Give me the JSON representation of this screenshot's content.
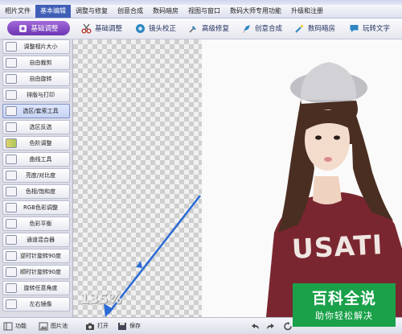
{
  "menu": {
    "items": [
      "相片文件",
      "基本编辑",
      "调整与修复",
      "创意合成",
      "数码暗房",
      "视图与窗口",
      "数码大师专用功能",
      "升级和注册"
    ],
    "active_index": 1
  },
  "toolbar": {
    "main_label": "基础调整",
    "tabs": [
      {
        "label": "基础调整",
        "icon": "scissors-icon"
      },
      {
        "label": "镜头校正",
        "icon": "lens-icon"
      },
      {
        "label": "高级修复",
        "icon": "pin-icon"
      },
      {
        "label": "创意合成",
        "icon": "rocket-icon"
      },
      {
        "label": "数码暗房",
        "icon": "magic-wand-icon"
      },
      {
        "label": "玩转文字",
        "icon": "chat-bubble-icon"
      }
    ]
  },
  "sidebar": {
    "items": [
      {
        "label": "调整相片大小"
      },
      {
        "label": "自由裁剪"
      },
      {
        "label": "自由旋转"
      },
      {
        "label": "排版与打印"
      },
      {
        "label": "选区/套索工具"
      },
      {
        "label": "选区反选"
      },
      {
        "label": "色阶调整"
      },
      {
        "label": "曲线工具"
      },
      {
        "label": "亮度/对比度"
      },
      {
        "label": "色相/饱和度"
      },
      {
        "label": "RGB色彩调整"
      },
      {
        "label": "色彩平衡"
      },
      {
        "label": "通道混合器"
      },
      {
        "label": "逆时针旋转90度"
      },
      {
        "label": "顺时针旋转90度"
      },
      {
        "label": "旋转任意角度"
      },
      {
        "label": "左右镜像"
      }
    ],
    "active_index": 4
  },
  "canvas": {
    "zoom": "135%",
    "photo_text": "USATI"
  },
  "statusbar": {
    "function_label": "功能",
    "album_label": "图片池",
    "open_label": "打开",
    "save_label": "保存"
  },
  "watermark": {
    "title": "百科全说",
    "subtitle": "助你轻松解决"
  },
  "colors": {
    "accent": "#3f5fb7",
    "main_button": "#8a4fc8",
    "arrow": "#2a6bd6",
    "watermark": "#1aa14a",
    "sweater": "#7a2630"
  }
}
